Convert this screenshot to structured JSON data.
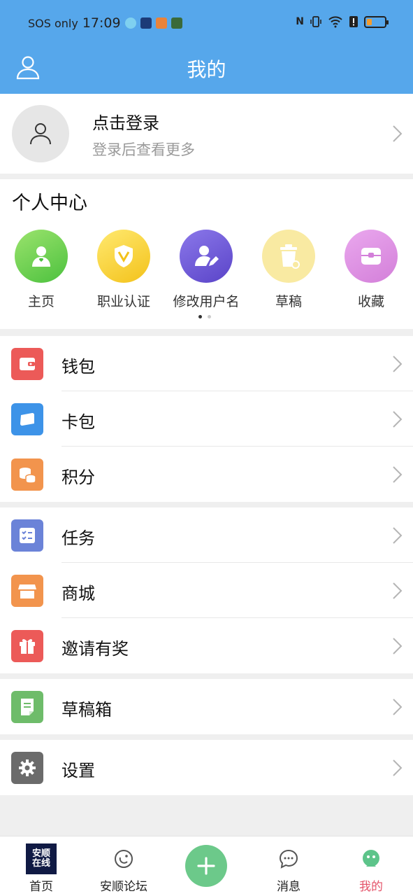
{
  "status_bar": {
    "carrier": "SOS only",
    "time": "17:09"
  },
  "header": {
    "title": "我的"
  },
  "login": {
    "title": "点击登录",
    "subtitle": "登录后查看更多"
  },
  "personal_center": {
    "title": "个人中心",
    "items": [
      {
        "label": "主页",
        "icon": "home-user-icon",
        "color": "#5ccf4f"
      },
      {
        "label": "职业认证",
        "icon": "shield-v-icon",
        "color": "#f6d130"
      },
      {
        "label": "修改用户名",
        "icon": "user-edit-icon",
        "color": "#6a56d4"
      },
      {
        "label": "草稿",
        "icon": "trash-draft-icon",
        "color": "#f7e48a"
      },
      {
        "label": "收藏",
        "icon": "collect-box-icon",
        "color": "#db8be0"
      }
    ]
  },
  "menu_groups": [
    [
      {
        "label": "钱包",
        "icon": "wallet-icon",
        "color": "#ec5a58"
      },
      {
        "label": "卡包",
        "icon": "card-icon",
        "color": "#3d93e8"
      },
      {
        "label": "积分",
        "icon": "coins-icon",
        "color": "#f2944d"
      }
    ],
    [
      {
        "label": "任务",
        "icon": "task-list-icon",
        "color": "#6b83d8"
      },
      {
        "label": "商城",
        "icon": "shop-icon",
        "color": "#f2944d"
      },
      {
        "label": "邀请有奖",
        "icon": "gift-icon",
        "color": "#ec5a58"
      }
    ],
    [
      {
        "label": "草稿箱",
        "icon": "draft-box-icon",
        "color": "#6ebc6a"
      }
    ],
    [
      {
        "label": "设置",
        "icon": "gear-icon",
        "color": "#6b6b6b"
      }
    ]
  ],
  "bottom_nav": {
    "items": [
      {
        "label": "首页",
        "icon": "home-logo-icon"
      },
      {
        "label": "安顺论坛",
        "icon": "forum-icon"
      },
      {
        "label": "消息",
        "icon": "message-icon"
      },
      {
        "label": "我的",
        "icon": "mine-icon"
      }
    ],
    "logo_text": "安顺在线",
    "active_color": "#e4546a"
  }
}
